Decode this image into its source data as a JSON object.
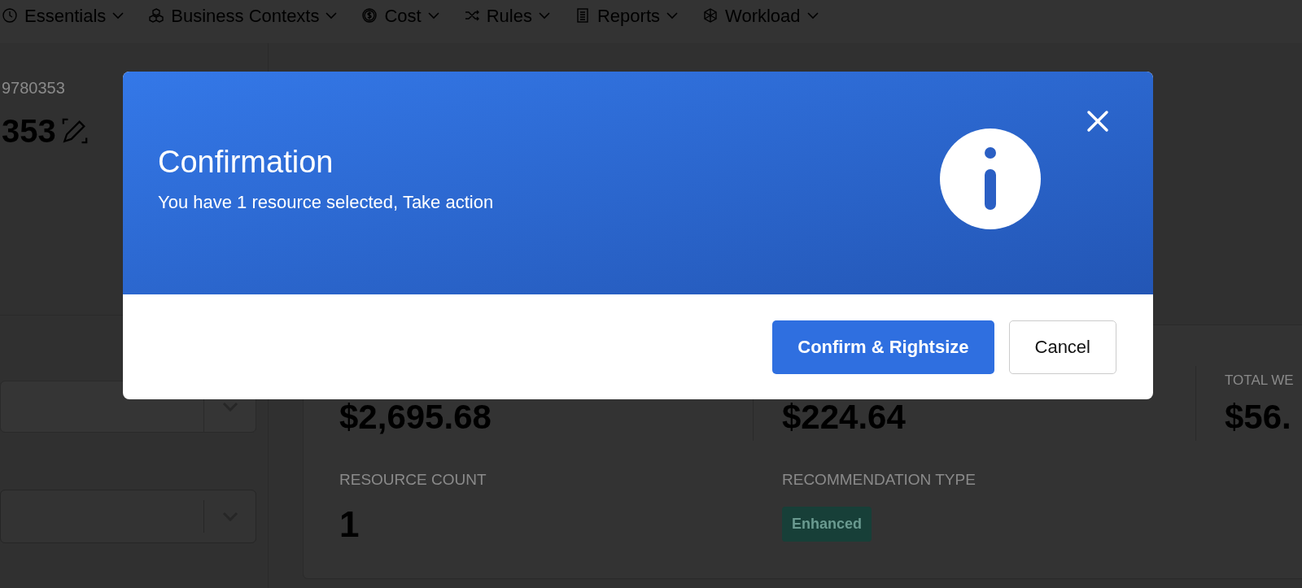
{
  "nav": [
    {
      "label": "Essentials"
    },
    {
      "label": "Business Contexts"
    },
    {
      "label": "Cost"
    },
    {
      "label": "Rules"
    },
    {
      "label": "Reports"
    },
    {
      "label": "Workload"
    }
  ],
  "header": {
    "id": "9780353",
    "name": "353"
  },
  "metrics": [
    {
      "value": "$2,695.68"
    },
    {
      "value": "$224.64"
    },
    {
      "label": "TOTAL WE",
      "value": "$56."
    }
  ],
  "details": [
    {
      "label": "RESOURCE COUNT",
      "value": "1",
      "kind": "text"
    },
    {
      "label": "RECOMMENDATION TYPE",
      "value": "Enhanced",
      "kind": "badge"
    }
  ],
  "dialog": {
    "title": "Confirmation",
    "message": "You have 1 resource selected, Take action",
    "buttons": [
      {
        "label": "Confirm & Rightsize",
        "kind": "primary"
      },
      {
        "label": "Cancel",
        "kind": "secondary"
      }
    ]
  }
}
